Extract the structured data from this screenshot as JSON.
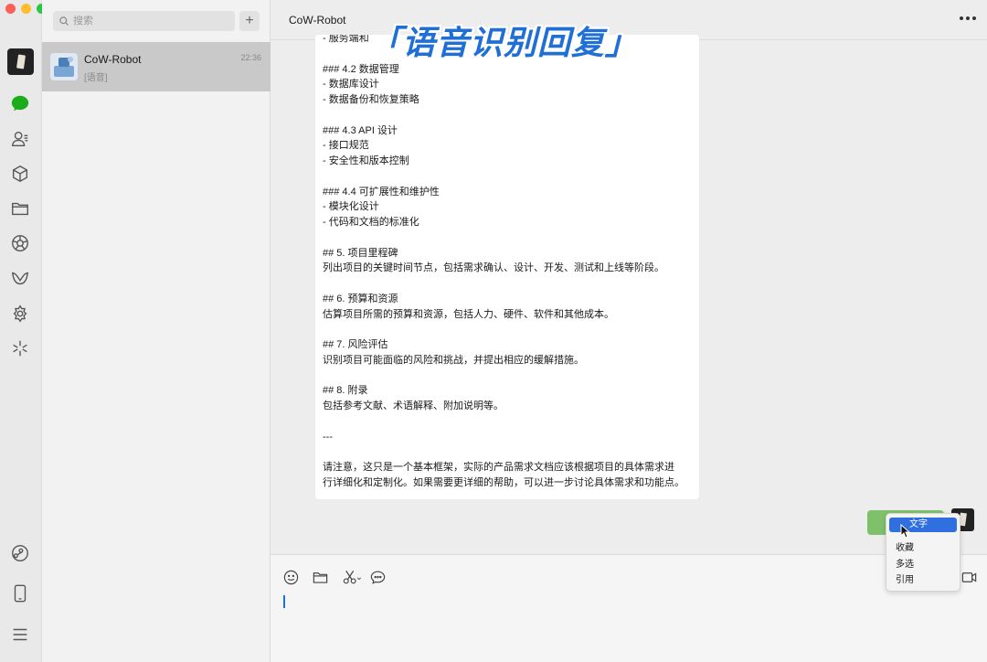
{
  "window": {
    "traffic_lights": [
      "close",
      "minimize",
      "zoom"
    ]
  },
  "rail": {
    "icons": [
      "avatar",
      "chat-icon",
      "contacts-icon",
      "cube-icon",
      "folder-icon",
      "moments-icon",
      "channels-icon",
      "mini-program-icon",
      "search-discover-icon",
      "phone-link-icon",
      "mobile-icon",
      "menu-icon"
    ]
  },
  "sidebar": {
    "search_placeholder": "搜索",
    "add_label": "+",
    "conversations": [
      {
        "name": "CoW-Robot",
        "time": "22:36",
        "preview": "[语音]"
      }
    ]
  },
  "chat": {
    "title": "CoW-Robot",
    "caption": "「语音识别回复」",
    "message_lines": [
      "- 服务端和",
      "",
      "### 4.2 数据管理",
      "- 数据库设计",
      "- 数据备份和恢复策略",
      "",
      "### 4.3 API 设计",
      "- 接口规范",
      "- 安全性和版本控制",
      "",
      "### 4.4 可扩展性和维护性",
      "- 模块化设计",
      "- 代码和文档的标准化",
      "",
      "## 5. 项目里程碑",
      "列出项目的关键时间节点，包括需求确认、设计、开发、测试和上线等阶段。",
      "",
      "## 6. 预算和资源",
      "估算项目所需的预算和资源，包括人力、硬件、软件和其他成本。",
      "",
      "## 7. 风险评估",
      "识别项目可能面临的风险和挑战，并提出相应的缓解措施。",
      "",
      "## 8. 附录",
      "包括参考文献、术语解释、附加说明等。",
      "",
      "---",
      "",
      "请注意，这只是一个基本框架，实际的产品需求文档应该根据项目的具体需求进",
      "行详细化和定制化。如果需要更详细的帮助，可以进一步讨论具体需求和功能点。"
    ],
    "context_menu": {
      "items": [
        "转文字",
        "收藏",
        "多选",
        "引用"
      ],
      "highlighted_index": 0,
      "highlighted_visible_text": "文字"
    }
  },
  "toolbar": {
    "tools": [
      "emoji-icon",
      "folder-icon",
      "scissors-icon",
      "chat-history-icon",
      "video-call-icon"
    ],
    "scissors_caret": "⌄"
  },
  "colors": {
    "accent_blue": "#2f6fdf",
    "voice_bubble_green": "#7ec16a",
    "caption_blue": "#1f6fd6"
  }
}
